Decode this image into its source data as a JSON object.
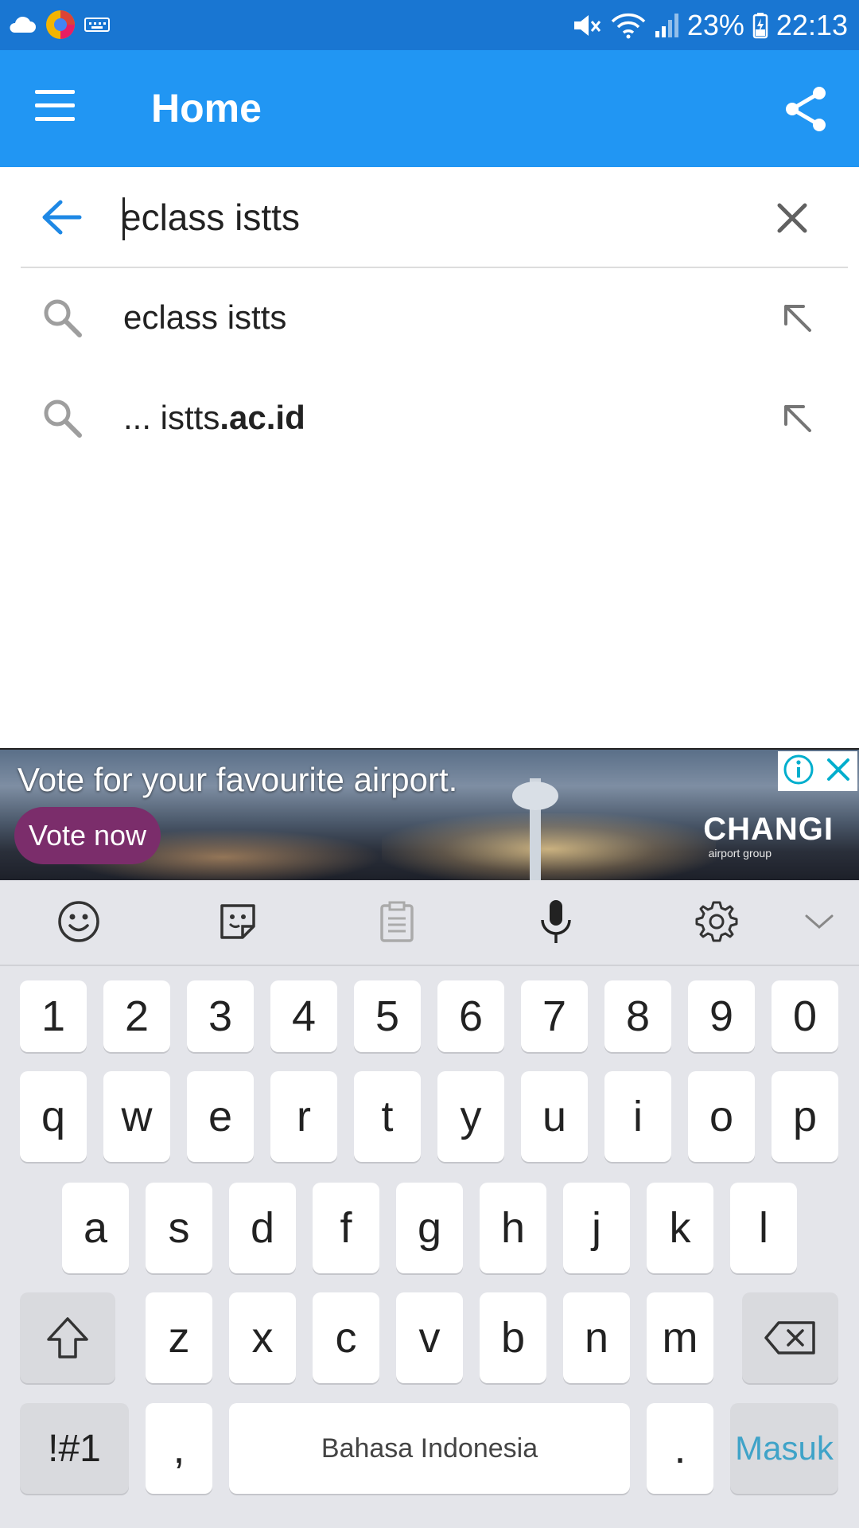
{
  "status_bar": {
    "battery": "23%",
    "time": "22:13",
    "left_icons": [
      "cloud-icon",
      "browser-app-icon",
      "keyboard-icon"
    ],
    "right_icons": [
      "mute-icon",
      "wifi-icon",
      "signal-icon",
      "battery-icon"
    ]
  },
  "app_bar": {
    "title": "Home",
    "menu_icon": "hamburger-menu-icon",
    "share_icon": "share-icon",
    "color": "#2196f3"
  },
  "search": {
    "value": "eclass istts",
    "back_icon": "back-arrow-icon",
    "clear_icon": "close-icon"
  },
  "suggestions": [
    {
      "prefix": "eclass istts",
      "bold": ""
    },
    {
      "prefix": "... istts",
      "bold": ".ac.id"
    }
  ],
  "ad": {
    "headline": "Vote for your favourite airport.",
    "button": "Vote now",
    "brand": "CHANGI",
    "brand_sub": "airport group"
  },
  "keyboard": {
    "toolbar_icons": [
      "emoji-icon",
      "sticker-icon",
      "clipboard-icon",
      "microphone-icon",
      "settings-icon",
      "chevron-down-icon"
    ],
    "number_row": [
      "1",
      "2",
      "3",
      "4",
      "5",
      "6",
      "7",
      "8",
      "9",
      "0"
    ],
    "row1": [
      "q",
      "w",
      "e",
      "r",
      "t",
      "y",
      "u",
      "i",
      "o",
      "p"
    ],
    "row2": [
      "a",
      "s",
      "d",
      "f",
      "g",
      "h",
      "j",
      "k",
      "l"
    ],
    "row3": [
      "z",
      "x",
      "c",
      "v",
      "b",
      "n",
      "m"
    ],
    "symbols_label": "!#1",
    "comma_label": ",",
    "space_label": "Bahasa Indonesia",
    "period_label": ".",
    "enter_label": "Masuk",
    "enter_color": "#3fa3c8"
  }
}
